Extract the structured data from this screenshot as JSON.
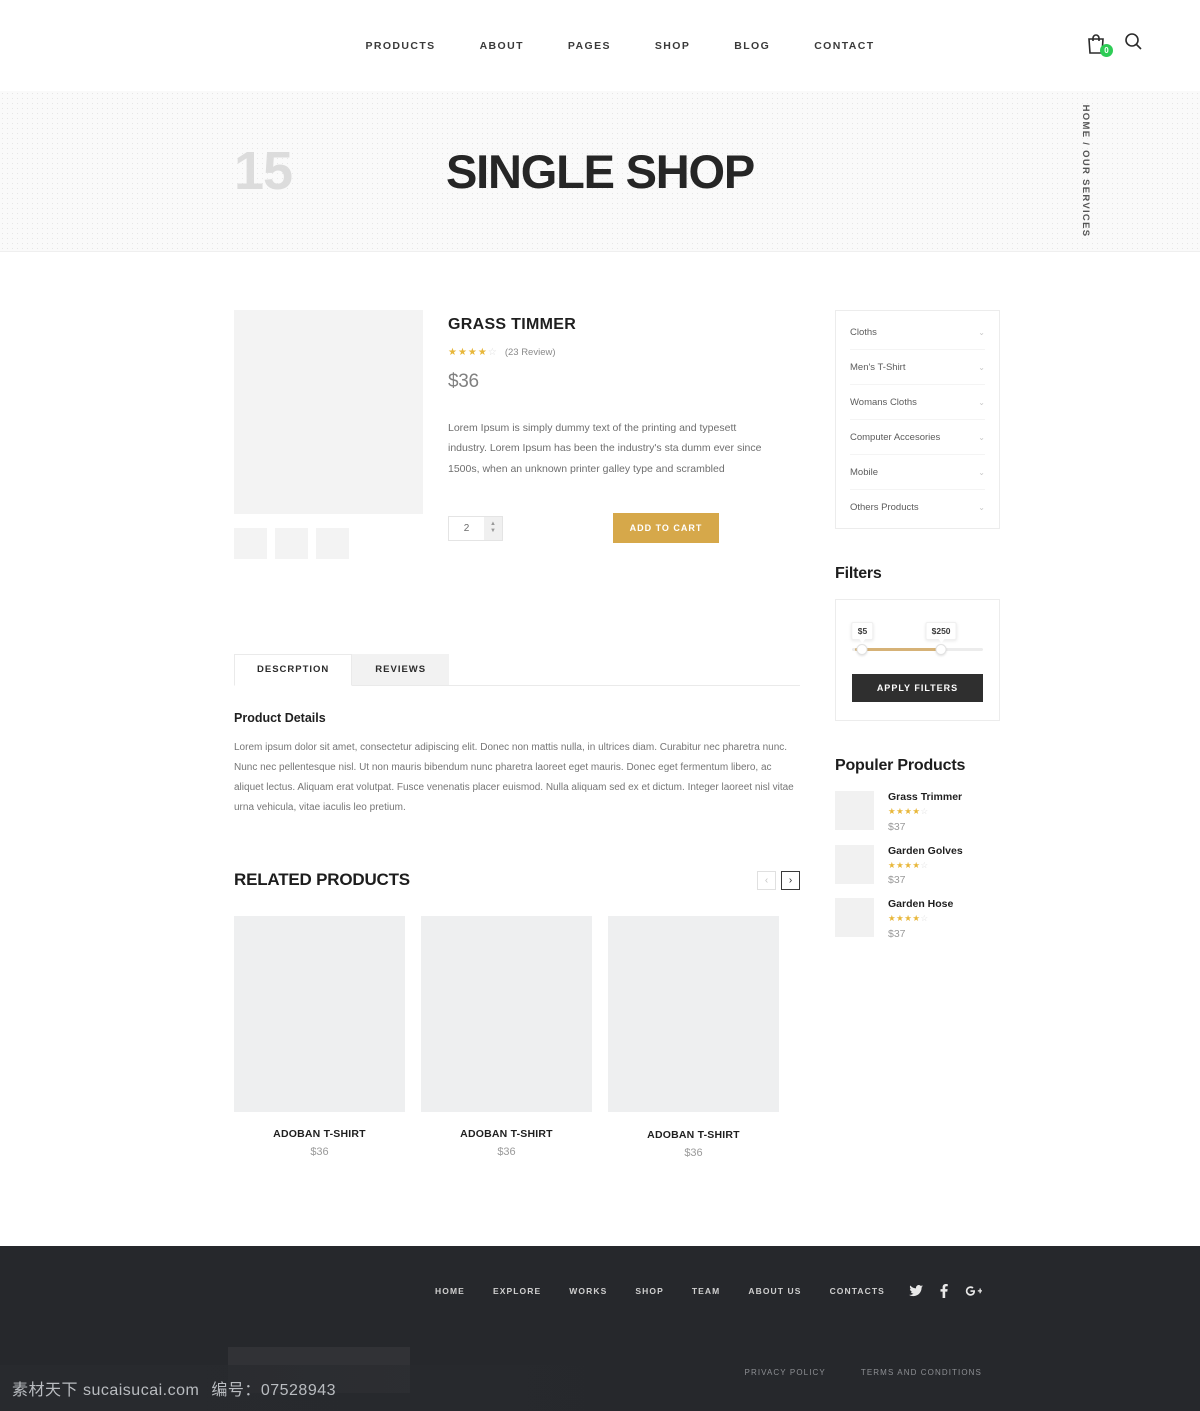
{
  "header": {
    "nav": [
      {
        "label": "PRODUCTS"
      },
      {
        "label": "ABOUT"
      },
      {
        "label": "PAGES"
      },
      {
        "label": "SHOP"
      },
      {
        "label": "BLOG"
      },
      {
        "label": "CONTACT"
      }
    ],
    "cart_count": "0",
    "cart_badge_color": "#2ecc56"
  },
  "banner": {
    "number": "15",
    "title": "SINGLE SHOP",
    "breadcrumb": "HOME / OUR SERVICES"
  },
  "product": {
    "title": "GRASS TIMMER",
    "stars_filled": 4,
    "stars_total": 5,
    "review_count": "(23 Review)",
    "price": "$36",
    "description": "Lorem Ipsum is simply dummy text of the printing and typesett industry. Lorem Ipsum has been the industry's sta dumm ever since 1500s, when an unknown printer galley type and scrambled",
    "quantity": "2",
    "add_to_cart_label": "ADD TO CART",
    "add_to_cart_color": "#d6a84a"
  },
  "tabs": {
    "items": [
      {
        "label": "DESCRPTION",
        "active": true
      },
      {
        "label": "REVIEWS",
        "active": false
      }
    ],
    "details_heading": "Product Details",
    "details_text": "Lorem ipsum dolor sit amet, consectetur adipiscing elit. Donec non mattis nulla, in ultrices diam. Curabitur nec pharetra nunc. Nunc nec pellentesque nisl. Ut non mauris bibendum nunc pharetra laoreet eget mauris. Donec eget fermentum libero, ac aliquet lectus. Aliquam erat volutpat. Fusce venenatis placer euismod. Nulla aliquam sed ex et dictum. Integer laoreet nisl vitae urna vehicula, vitae iaculis leo pretium."
  },
  "related": {
    "title": "RELATED PRODUCTS",
    "prev_label": "‹",
    "next_label": "›",
    "items": [
      {
        "name": "ADOBAN T-SHIRT",
        "price": "$36"
      },
      {
        "name": "ADOBAN T-SHIRT",
        "price": "$36"
      },
      {
        "name": "ADOBAN T-SHIRT",
        "price": "$36"
      }
    ]
  },
  "sidebar": {
    "categories": [
      {
        "label": "Cloths"
      },
      {
        "label": "Men's T-Shirt"
      },
      {
        "label": "Womans Cloths"
      },
      {
        "label": "Computer Accesories"
      },
      {
        "label": "Mobile"
      },
      {
        "label": "Others Products"
      }
    ],
    "filters": {
      "heading": "Filters",
      "min_price": "$5",
      "max_price": "$250",
      "apply_label": "APPLY FILTERS",
      "track_color": "#d6b277"
    },
    "popular": {
      "heading": "Populer Products",
      "items": [
        {
          "name": "Grass Trimmer",
          "price": "$37",
          "stars_filled": 4
        },
        {
          "name": "Garden Golves",
          "price": "$37",
          "stars_filled": 4
        },
        {
          "name": "Garden Hose",
          "price": "$37",
          "stars_filled": 4
        }
      ]
    }
  },
  "footer": {
    "nav": [
      {
        "label": "HOME"
      },
      {
        "label": "EXPLORE"
      },
      {
        "label": "WORKS"
      },
      {
        "label": "SHOP"
      },
      {
        "label": "TEAM"
      },
      {
        "label": "ABOUT US"
      },
      {
        "label": "CONTACTS"
      }
    ],
    "socials": [
      {
        "name": "twitter-icon",
        "glyph": "🐦"
      },
      {
        "name": "facebook-icon",
        "glyph": "f"
      },
      {
        "name": "google-plus-icon",
        "glyph": "G+"
      }
    ],
    "legal": [
      {
        "label": "PRIVACY POLICY"
      },
      {
        "label": "TERMS AND CONDITIONS"
      }
    ]
  },
  "watermark": {
    "site": "素材天下 sucaisucai.com",
    "code": "编号：07528943"
  }
}
